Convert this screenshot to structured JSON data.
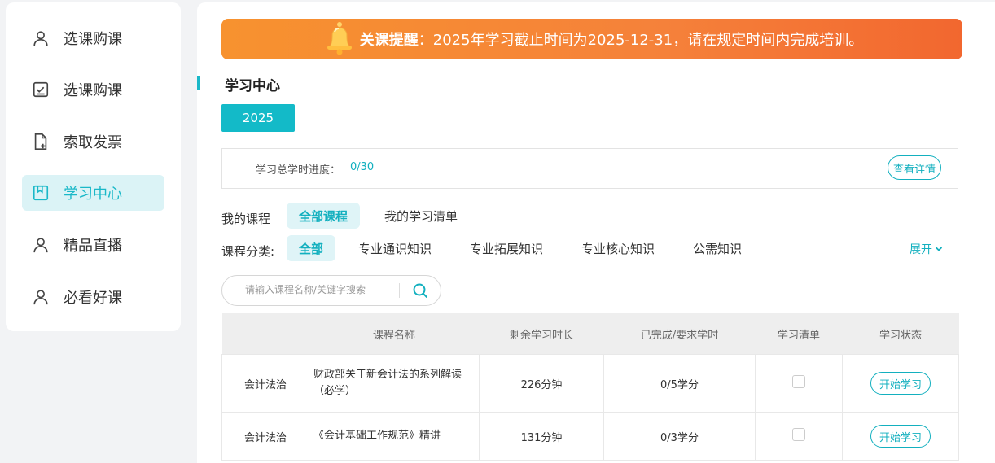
{
  "sidebar": {
    "items": [
      {
        "label": "选课购课",
        "icon": "user-icon",
        "active": false
      },
      {
        "label": "选课购课",
        "icon": "checklist-icon",
        "active": false
      },
      {
        "label": "索取发票",
        "icon": "invoice-icon",
        "active": false
      },
      {
        "label": "学习中心",
        "icon": "bookmark-icon",
        "active": true
      },
      {
        "label": "精品直播",
        "icon": "user-icon",
        "active": false
      },
      {
        "label": "必看好课",
        "icon": "user-icon",
        "active": false
      }
    ]
  },
  "banner": {
    "title": "关课提醒",
    "message": "：2025年学习截止时间为2025-12-31，请在规定时间内完成培训。"
  },
  "section": {
    "title": "学习中心"
  },
  "year": {
    "label": "2025"
  },
  "progress": {
    "label": "学习总学时进度：",
    "value": "0/30",
    "detail_button": "查看详情"
  },
  "my_courses": {
    "label": "我的课程",
    "tabs": [
      "全部课程",
      "我的学习清单"
    ]
  },
  "categories": {
    "label": "课程分类:",
    "items": [
      "全部",
      "专业通识知识",
      "专业拓展知识",
      "专业核心知识",
      "公需知识"
    ],
    "expand": "展开"
  },
  "search": {
    "placeholder": "请输入课程名称/关键字搜索"
  },
  "table": {
    "headers": [
      "",
      "课程名称",
      "剩余学习时长",
      "已完成/要求学时",
      "学习清单",
      "学习状态"
    ],
    "rows": [
      {
        "category": "会计法治",
        "name": "财政部关于新会计法的系列解读（必学）",
        "remaining": "226分钟",
        "credits": "0/5学分",
        "action": "开始学习"
      },
      {
        "category": "会计法治",
        "name": "《会计基础工作规范》精讲",
        "remaining": "131分钟",
        "credits": "0/3学分",
        "action": "开始学习"
      }
    ]
  },
  "colors": {
    "accent": "#13b0bf",
    "banner": "#f5813a"
  }
}
